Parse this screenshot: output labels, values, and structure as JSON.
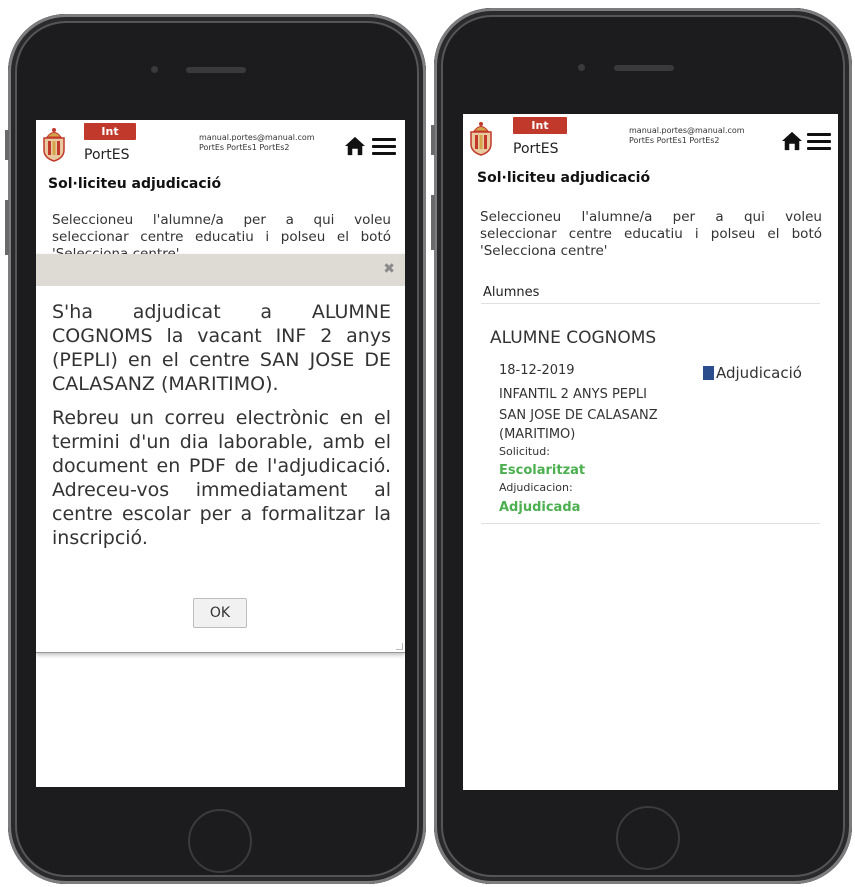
{
  "app": {
    "badge": "Int",
    "name": "PortES",
    "user_email": "manual.portes@manual.com",
    "user_name": "PortEs PortEs1 PortEs2",
    "icons": {
      "logo": "city-shield-logo",
      "home": "home-icon",
      "menu": "hamburger-menu-icon"
    }
  },
  "colors": {
    "brand_red": "#c0392b",
    "status_green": "#4caf50",
    "modal_bar": "#dedbd5"
  },
  "page": {
    "title": "Sol·liciteu adjudicació",
    "instructions": "Seleccioneu l'alumne/a per a qui voleu seleccionar centre educatiu i polseu el botó 'Selecciona centre'"
  },
  "left_screen": {
    "truncated_instructions_line3": "'Selecciona centre'",
    "modal": {
      "close_symbol": "✖",
      "paragraph1": "S'ha adjudicat a ALUMNE COGNOMS la vacant INF 2 anys (PEPLI) en el centre SAN JOSE DE CALASANZ (MARITIMO).",
      "paragraph2": "Rebreu un correu electrònic en el termini d'un dia laborable, amb el document en PDF de l'adjudicació. Adreceu-vos immediatament al centre escolar per a formalitzar la inscripció.",
      "ok_label": "OK"
    }
  },
  "right_screen": {
    "section_label": "Alumnes",
    "student": {
      "name": "ALUMNE COGNOMS",
      "date": "18-12-2019",
      "level": "INFANTIL 2 ANYS PEPLI",
      "centre_line1": "SAN JOSE DE CALASANZ",
      "centre_line2": "(MARITIMO)",
      "solicitud_label": "Solicitud:",
      "solicitud_value": "Escolaritzat",
      "adjudicacion_label": "Adjudicacion:",
      "adjudicacion_value": "Adjudicada",
      "pdf_link": "Adjudicació"
    }
  }
}
